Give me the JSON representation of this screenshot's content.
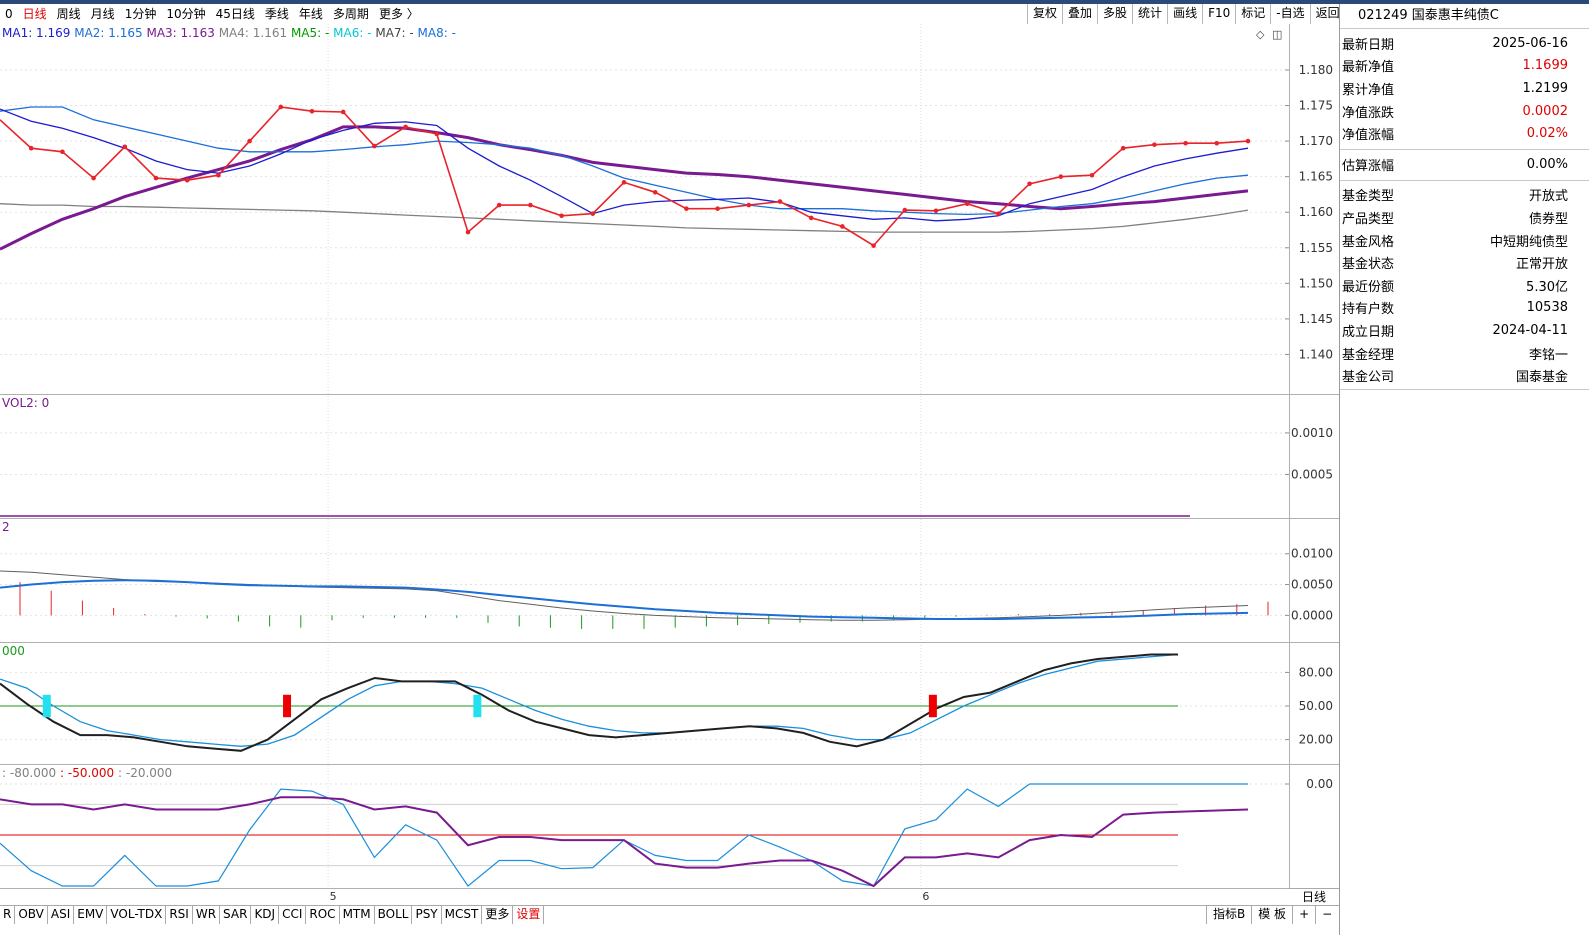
{
  "period_tabs": [
    {
      "label": "0",
      "active": false
    },
    {
      "label": "日线",
      "active": true
    },
    {
      "label": "周线",
      "active": false
    },
    {
      "label": "月线",
      "active": false
    },
    {
      "label": "1分钟",
      "active": false
    },
    {
      "label": "10分钟",
      "active": false
    },
    {
      "label": "45日线",
      "active": false
    },
    {
      "label": "季线",
      "active": false
    },
    {
      "label": "年线",
      "active": false
    },
    {
      "label": "多周期",
      "active": false
    },
    {
      "label": "更多 〉",
      "active": false
    }
  ],
  "toolbar": [
    "复权",
    "叠加",
    "多股",
    "统计",
    "画线",
    "F10",
    "标记",
    "-自选",
    "返回"
  ],
  "info_panel": {
    "title": "021249 国泰惠丰纯债C",
    "group1": [
      {
        "label": "最新日期",
        "value": "2025-06-16",
        "color": "#000000"
      },
      {
        "label": "最新净值",
        "value": "1.1699",
        "color": "#e00000"
      },
      {
        "label": "累计净值",
        "value": "1.2199",
        "color": "#000000"
      },
      {
        "label": "净值涨跌",
        "value": "0.0002",
        "color": "#e00000"
      },
      {
        "label": "净值涨幅",
        "value": "0.02%",
        "color": "#e00000"
      }
    ],
    "group2": [
      {
        "label": "估算涨幅",
        "value": "0.00%",
        "color": "#000000"
      }
    ],
    "group3": [
      {
        "label": "基金类型",
        "value": "开放式",
        "color": "#000000"
      },
      {
        "label": "产品类型",
        "value": "债券型",
        "color": "#000000"
      },
      {
        "label": "基金风格",
        "value": "中短期纯债型",
        "color": "#000000"
      },
      {
        "label": "基金状态",
        "value": "正常开放",
        "color": "#000000"
      },
      {
        "label": "最近份额",
        "value": "5.30亿",
        "color": "#000000"
      },
      {
        "label": "持有户数",
        "value": "10538",
        "color": "#000000"
      },
      {
        "label": "成立日期",
        "value": "2024-04-11",
        "color": "#000000"
      },
      {
        "label": "基金经理",
        "value": "李铭一",
        "color": "#000000"
      },
      {
        "label": "基金公司",
        "value": "国泰基金",
        "color": "#000000"
      }
    ]
  },
  "bottom_tabs": [
    {
      "label": "R",
      "color": "#000000"
    },
    {
      "label": "OBV",
      "color": "#000000"
    },
    {
      "label": "ASI",
      "color": "#000000"
    },
    {
      "label": "EMV",
      "color": "#000000"
    },
    {
      "label": "VOL-TDX",
      "color": "#000000"
    },
    {
      "label": "RSI",
      "color": "#000000"
    },
    {
      "label": "WR",
      "color": "#000000"
    },
    {
      "label": "SAR",
      "color": "#000000"
    },
    {
      "label": "KDJ",
      "color": "#000000"
    },
    {
      "label": "CCI",
      "color": "#000000"
    },
    {
      "label": "ROC",
      "color": "#000000"
    },
    {
      "label": "MTM",
      "color": "#000000"
    },
    {
      "label": "BOLL",
      "color": "#000000"
    },
    {
      "label": "PSY",
      "color": "#000000"
    },
    {
      "label": "MCST",
      "color": "#000000"
    },
    {
      "label": "更多",
      "color": "#000000"
    },
    {
      "label": "设置",
      "color": "#e00000"
    }
  ],
  "bottom_right_tabs": [
    "指标B",
    "模 板",
    "+",
    "−"
  ],
  "day_label": "日线",
  "chart_data": [
    {
      "type": "line",
      "panel": "main",
      "legend": [
        {
          "text": "MA1: 1.169",
          "color": "#1c1cd0"
        },
        {
          "text": "MA2: 1.165",
          "color": "#1a6fd8"
        },
        {
          "text": "MA3: 1.163",
          "color": "#7a1a90"
        },
        {
          "text": "MA4: 1.161",
          "color": "#808080"
        },
        {
          "text": "MA5: -",
          "color": "#009900"
        },
        {
          "text": "MA6: -",
          "color": "#00c8d8"
        },
        {
          "text": "MA7: -",
          "color": "#444444"
        },
        {
          "text": "MA8: -",
          "color": "#1a6fd8"
        }
      ],
      "ylim": [
        1.135,
        1.1845
      ],
      "yticks": [
        "1.180",
        "1.175",
        "1.170",
        "1.165",
        "1.160",
        "1.155",
        "1.150",
        "1.145",
        "1.140"
      ],
      "x_labels": [
        {
          "index": 10.5,
          "text": "5"
        },
        {
          "index": 29.5,
          "text": "6"
        }
      ],
      "series": [
        {
          "name": "NAV",
          "color": "#e8232a",
          "values": [
            1.173,
            1.169,
            1.1685,
            1.1648,
            1.1692,
            1.1648,
            1.1645,
            1.1652,
            1.17,
            1.1748,
            1.1742,
            1.1741,
            1.1693,
            1.172,
            1.171,
            1.1572,
            1.161,
            1.161,
            1.1595,
            1.1598,
            1.1642,
            1.1628,
            1.1605,
            1.1605,
            1.161,
            1.1615,
            1.1592,
            1.158,
            1.1553,
            1.1603,
            1.1602,
            1.1612,
            1.1598,
            1.164,
            1.165,
            1.1652,
            1.169,
            1.1695,
            1.1697,
            1.1697,
            1.17
          ]
        },
        {
          "name": "MA1",
          "color": "#1c1cd0",
          "values": [
            1.1745,
            1.1728,
            1.1718,
            1.1705,
            1.169,
            1.1672,
            1.166,
            1.1655,
            1.1665,
            1.1682,
            1.1702,
            1.1715,
            1.1725,
            1.1727,
            1.1722,
            1.169,
            1.1665,
            1.1645,
            1.1622,
            1.1598,
            1.161,
            1.1615,
            1.1617,
            1.1618,
            1.162,
            1.1614,
            1.16,
            1.1595,
            1.159,
            1.1592,
            1.1588,
            1.159,
            1.1595,
            1.1612,
            1.1622,
            1.1632,
            1.165,
            1.1665,
            1.1675,
            1.1683,
            1.169
          ]
        },
        {
          "name": "MA2",
          "color": "#1a6fd8",
          "values": [
            1.1742,
            1.1748,
            1.1748,
            1.173,
            1.172,
            1.171,
            1.17,
            1.169,
            1.1685,
            1.1685,
            1.1685,
            1.1688,
            1.1692,
            1.1695,
            1.17,
            1.1698,
            1.1695,
            1.169,
            1.168,
            1.1665,
            1.1648,
            1.1638,
            1.1628,
            1.1618,
            1.161,
            1.1605,
            1.1605,
            1.1605,
            1.1602,
            1.16,
            1.1598,
            1.1597,
            1.1598,
            1.1603,
            1.1608,
            1.1612,
            1.162,
            1.163,
            1.164,
            1.1648,
            1.1652
          ]
        },
        {
          "name": "MA3",
          "color": "#7a1a90",
          "values": [
            1.1548,
            1.157,
            1.159,
            1.1605,
            1.1622,
            1.1635,
            1.1648,
            1.166,
            1.1672,
            1.1688,
            1.1702,
            1.172,
            1.172,
            1.1718,
            1.1712,
            1.1705,
            1.1695,
            1.1688,
            1.168,
            1.167,
            1.1665,
            1.166,
            1.1655,
            1.1653,
            1.165,
            1.1645,
            1.164,
            1.1635,
            1.163,
            1.1625,
            1.162,
            1.1615,
            1.1612,
            1.1608,
            1.1605,
            1.1608,
            1.1612,
            1.1615,
            1.162,
            1.1625,
            1.163
          ]
        },
        {
          "name": "MA4",
          "color": "#808080",
          "values": [
            1.1612,
            1.161,
            1.161,
            1.1608,
            1.1608,
            1.1607,
            1.1606,
            1.1605,
            1.1604,
            1.1603,
            1.1602,
            1.16,
            1.1598,
            1.1596,
            1.1594,
            1.1592,
            1.159,
            1.1588,
            1.1586,
            1.1584,
            1.1582,
            1.158,
            1.1578,
            1.1577,
            1.1576,
            1.1575,
            1.1574,
            1.1573,
            1.1572,
            1.1572,
            1.1572,
            1.1572,
            1.1572,
            1.1573,
            1.1575,
            1.1577,
            1.158,
            1.1585,
            1.159,
            1.1596,
            1.1603
          ]
        }
      ]
    },
    {
      "type": "line",
      "panel": "vol",
      "legend": [
        {
          "text": "VOL2: 0",
          "color": "#7a1a90"
        }
      ],
      "ylim": [
        0,
        0.0013
      ],
      "yticks": [
        "0.0010",
        "0.0005"
      ],
      "series": [
        {
          "name": "VOL2",
          "color": "#7a1a90",
          "values": [
            0,
            0
          ]
        }
      ]
    },
    {
      "type": "bar",
      "panel": "macd",
      "legend": [
        {
          "text": "2",
          "color": "#7a1a90"
        }
      ],
      "ylim": [
        -0.004,
        0.0145
      ],
      "yticks": [
        "0.0100",
        "0.0050",
        "0.0000"
      ],
      "series": [
        {
          "name": "DIF",
          "color": "#606060",
          "values": [
            0.0072,
            0.007,
            0.0066,
            0.0062,
            0.0058,
            0.0055,
            0.0054,
            0.0052,
            0.005,
            0.0048,
            0.0046,
            0.0045,
            0.0044,
            0.0043,
            0.004,
            0.0032,
            0.0024,
            0.0018,
            0.0012,
            0.0007,
            0.0003,
            0.0,
            -0.0002,
            -0.0004,
            -0.0005,
            -0.0006,
            -0.0007,
            -0.0008,
            -0.0008,
            -0.0007,
            -0.0006,
            -0.0005,
            -0.0004,
            -0.0002,
            0.0,
            0.0003,
            0.0006,
            0.0009,
            0.0012,
            0.0014,
            0.0016
          ]
        },
        {
          "name": "DEA",
          "color": "#1a6fd8",
          "values": [
            0.0045,
            0.005,
            0.0054,
            0.0056,
            0.0057,
            0.0056,
            0.0054,
            0.0051,
            0.0049,
            0.0048,
            0.0047,
            0.0047,
            0.0046,
            0.0045,
            0.0042,
            0.0038,
            0.0033,
            0.0028,
            0.0023,
            0.0018,
            0.0014,
            0.001,
            0.0007,
            0.0004,
            0.0002,
            0.0,
            -0.0002,
            -0.0003,
            -0.0004,
            -0.0005,
            -0.0006,
            -0.0006,
            -0.0006,
            -0.0005,
            -0.0004,
            -0.0003,
            -0.0002,
            0.0,
            0.0002,
            0.0003,
            0.0004
          ]
        },
        {
          "name": "MACD",
          "color": "#e8232a",
          "negative_color": "#1a9a1a",
          "values": [
            0.0054,
            0.004,
            0.0024,
            0.0012,
            0.0002,
            -0.0002,
            -0.0005,
            -0.001,
            -0.0018,
            -0.002,
            -0.0008,
            -0.0004,
            -0.0004,
            -0.0004,
            -0.0004,
            -0.0012,
            -0.0018,
            -0.002,
            -0.0022,
            -0.0022,
            -0.0022,
            -0.002,
            -0.0018,
            -0.0016,
            -0.0014,
            -0.0012,
            -0.001,
            -0.001,
            -0.0008,
            -0.0004,
            -0.0002,
            0.0001,
            0.0002,
            0.0002,
            0.0004,
            0.0006,
            0.0008,
            0.0012,
            0.0016,
            0.0018,
            0.0022
          ]
        }
      ]
    },
    {
      "type": "line",
      "panel": "kdj",
      "legend": [
        {
          "text": "000",
          "color": "#1a9a1a"
        }
      ],
      "ylim": [
        0,
        100
      ],
      "yticks": [
        "80.00",
        "50.00",
        "20.00"
      ],
      "series": [
        {
          "name": "K",
          "color": "#202020",
          "values": [
            70,
            52,
            36,
            24,
            24,
            22,
            18,
            14,
            12,
            10,
            20,
            38,
            56,
            66,
            75,
            72,
            72,
            72,
            60,
            46,
            36,
            30,
            24,
            22,
            24,
            26,
            28,
            30,
            32,
            30,
            26,
            18,
            14,
            20,
            34,
            48,
            58,
            62,
            72,
            82,
            88,
            92,
            94,
            96,
            96
          ]
        },
        {
          "name": "D",
          "color": "#1a8fdc",
          "values": [
            74,
            66,
            50,
            36,
            28,
            24,
            20,
            18,
            16,
            14,
            16,
            24,
            40,
            56,
            68,
            72,
            72,
            70,
            66,
            56,
            46,
            38,
            32,
            28,
            26,
            26,
            28,
            30,
            32,
            32,
            30,
            24,
            20,
            20,
            26,
            38,
            50,
            60,
            70,
            78,
            84,
            90,
            92,
            94,
            96
          ]
        },
        {
          "name": "J-level",
          "color": "#1a9a1a",
          "values": [
            50
          ]
        }
      ],
      "signals": [
        {
          "index": 1.5,
          "kind": "sell",
          "color": "#22e0f0"
        },
        {
          "index": 9.2,
          "kind": "buy",
          "color": "#ee0000"
        },
        {
          "index": 15.3,
          "kind": "sell",
          "color": "#22e0f0"
        },
        {
          "index": 29.9,
          "kind": "buy",
          "color": "#ee0000"
        }
      ]
    },
    {
      "type": "line",
      "panel": "wr",
      "legend": [
        {
          "text": ": -80.000",
          "color": "#808080"
        },
        {
          "text": ": -50.000",
          "color": "#e00000"
        },
        {
          "text": ": -20.000",
          "color": "#808080"
        }
      ],
      "ylim": [
        -100,
        0
      ],
      "yticks": [
        "0.00"
      ],
      "series": [
        {
          "name": "WR1",
          "color": "#1a8fdc",
          "values": [
            -58,
            -85,
            -100,
            -100,
            -70,
            -100,
            -100,
            -95,
            -45,
            -5,
            -7,
            -20,
            -72,
            -40,
            -55,
            -100,
            -75,
            -75,
            -83,
            -82,
            -55,
            -70,
            -75,
            -75,
            -50,
            -62,
            -75,
            -95,
            -100,
            -44,
            -35,
            -5,
            -22,
            0,
            0,
            0,
            0,
            0,
            0,
            0,
            0
          ]
        },
        {
          "name": "WR2",
          "color": "#7a1a90",
          "values": [
            -15,
            -20,
            -20,
            -25,
            -20,
            -25,
            -25,
            -25,
            -20,
            -13,
            -13,
            -15,
            -25,
            -22,
            -28,
            -60,
            -52,
            -52,
            -55,
            -55,
            -55,
            -78,
            -82,
            -82,
            -78,
            -75,
            -75,
            -85,
            -100,
            -72,
            -72,
            -68,
            -72,
            -55,
            -50,
            -52,
            -30,
            -28,
            -27,
            -26,
            -25
          ]
        },
        {
          "name": "WR-mid",
          "color": "#e00000",
          "values": [
            -50
          ]
        }
      ]
    }
  ]
}
